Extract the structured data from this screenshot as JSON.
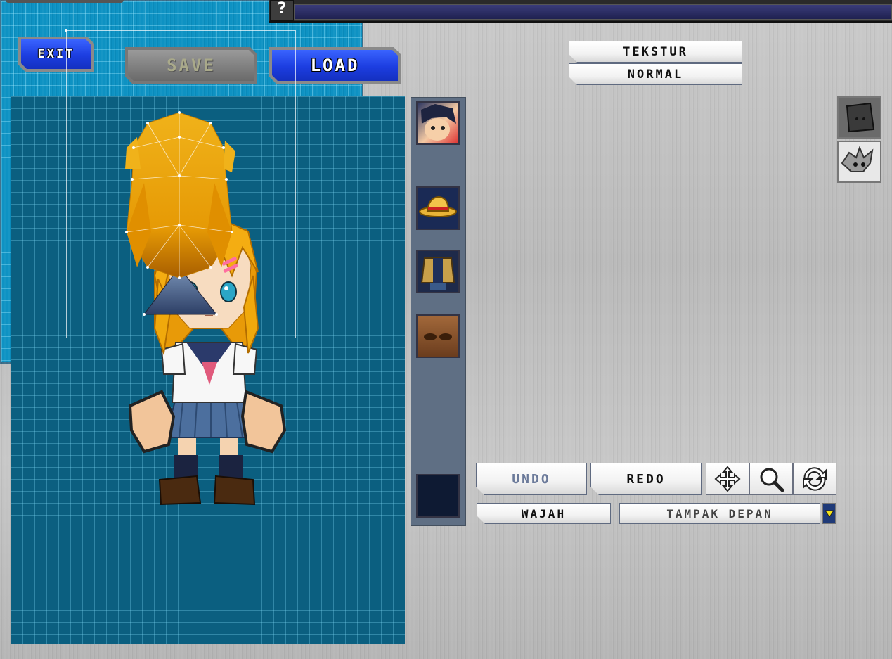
{
  "top": {
    "help_label": "?"
  },
  "toolbar": {
    "exit_label": "EXIT",
    "save_label": "SAVE",
    "load_label": "LOAD"
  },
  "texture_panel": {
    "texture_label": "TEKSTUR",
    "mode_label": "NORMAL"
  },
  "parts": [
    {
      "name": "face-portrait"
    },
    {
      "name": "hat"
    },
    {
      "name": "body"
    },
    {
      "name": "face-texture"
    },
    {
      "name": "empty-slot"
    }
  ],
  "editor": {
    "undo_label": "UNDO",
    "redo_label": "REDO",
    "part_label": "WAJAH",
    "view_label": "TAMPAK DEPAN"
  },
  "icons": {
    "move": "move-icon",
    "zoom": "zoom-icon",
    "rotate": "rotate-icon"
  },
  "colors": {
    "accent_blue": "#1c3de0",
    "canvas_dark": "#0b5f80",
    "canvas_light": "#0990c2",
    "hair": "#f0a90c"
  }
}
